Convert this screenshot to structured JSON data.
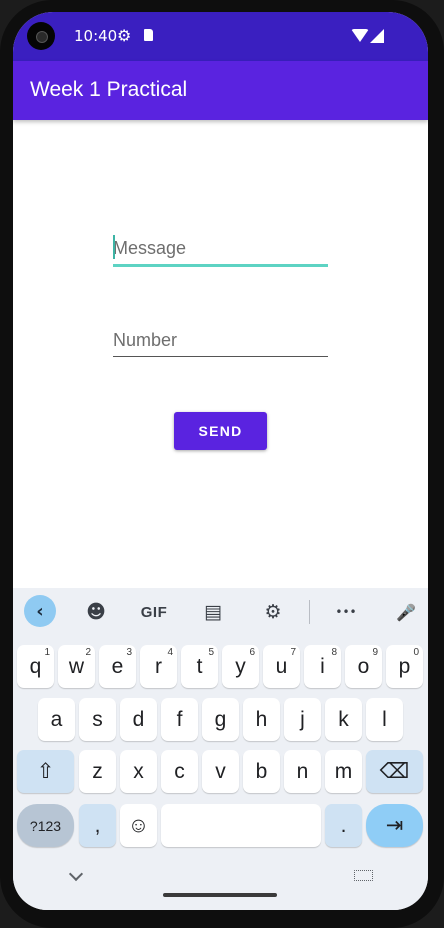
{
  "status_bar": {
    "time": "10:40",
    "icons": [
      "gear-icon",
      "sd-card-icon",
      "wifi-icon",
      "signal-icon"
    ]
  },
  "app_bar": {
    "title": "Week 1 Practical"
  },
  "form": {
    "message_placeholder": "Message",
    "number_placeholder": "Number",
    "send_label": "SEND"
  },
  "keyboard": {
    "toolbar": {
      "back": "‹",
      "sticker": "☻",
      "gif": "GIF",
      "clipboard": "▤",
      "settings": "⚙",
      "more": "•••",
      "mic": "🎤"
    },
    "row1": [
      {
        "k": "q",
        "h": "1"
      },
      {
        "k": "w",
        "h": "2"
      },
      {
        "k": "e",
        "h": "3"
      },
      {
        "k": "r",
        "h": "4"
      },
      {
        "k": "t",
        "h": "5"
      },
      {
        "k": "y",
        "h": "6"
      },
      {
        "k": "u",
        "h": "7"
      },
      {
        "k": "i",
        "h": "8"
      },
      {
        "k": "o",
        "h": "9"
      },
      {
        "k": "p",
        "h": "0"
      }
    ],
    "row2": [
      "a",
      "s",
      "d",
      "f",
      "g",
      "h",
      "j",
      "k",
      "l"
    ],
    "row3": [
      "z",
      "x",
      "c",
      "v",
      "b",
      "n",
      "m"
    ],
    "shift": "⇧",
    "backspace": "⌫",
    "symbols": "?123",
    "comma": ",",
    "emoji": "☺",
    "period": ".",
    "enter": "⇥"
  },
  "colors": {
    "status_bar": "#3a1fc0",
    "app_bar": "#5a23e0",
    "accent_teal": "#5dd3c3",
    "button": "#5a23e0"
  }
}
